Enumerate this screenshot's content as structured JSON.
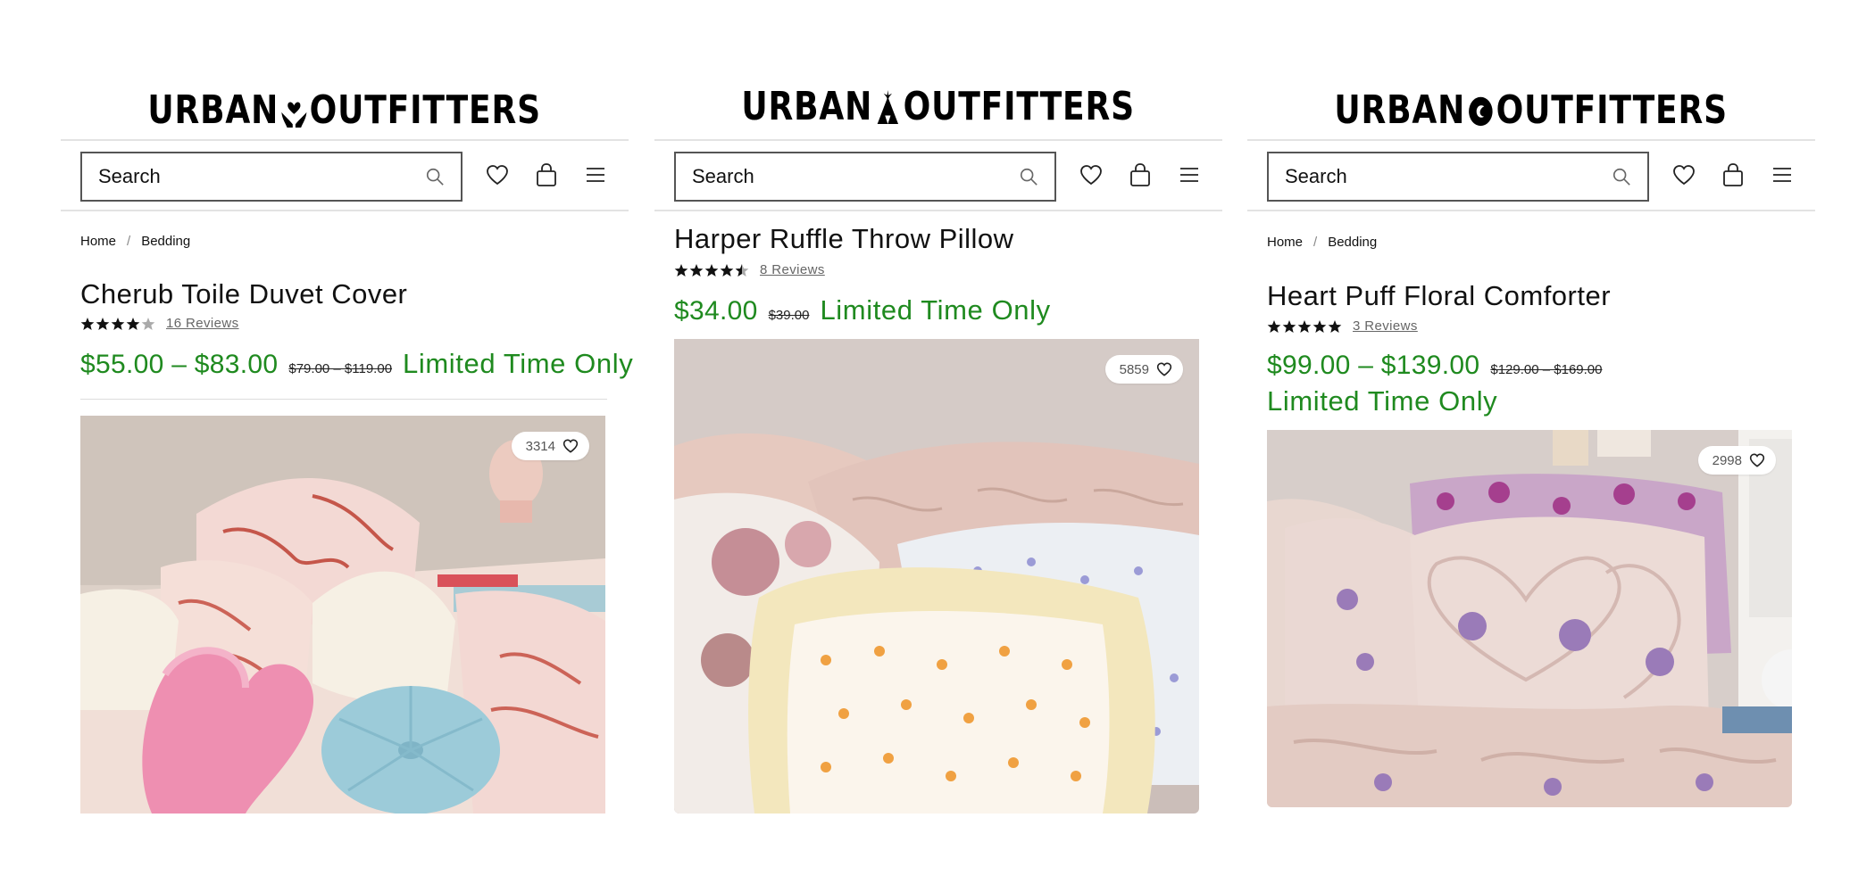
{
  "brand": {
    "logo_left": "URBAN",
    "logo_right": "OUTFITTERS",
    "logo_marks": [
      "hands-heart-logo-mark",
      "tent-logo-mark",
      "circle-logo-mark"
    ]
  },
  "colors": {
    "sale_green": "#1f8a1f",
    "text": "#111111",
    "border": "#555555"
  },
  "panels": [
    {
      "search": {
        "placeholder": "Search"
      },
      "breadcrumb": {
        "home": "Home",
        "separator": "/",
        "category": "Bedding"
      },
      "product": {
        "title": "Cherub Toile Duvet Cover",
        "rating": 4,
        "reviews": "16 Reviews",
        "price": "$55.00 – $83.00",
        "original_price": "$79.00 – $119.00",
        "promo": "Limited Time Only",
        "favorites": "3314"
      }
    },
    {
      "search": {
        "placeholder": "Search"
      },
      "product": {
        "title": "Harper Ruffle Throw Pillow",
        "rating": 4.5,
        "reviews": "8 Reviews",
        "price": "$34.00",
        "original_price": "$39.00",
        "promo": "Limited Time Only",
        "favorites": "5859"
      }
    },
    {
      "search": {
        "placeholder": "Search"
      },
      "breadcrumb": {
        "home": "Home",
        "separator": "/",
        "category": "Bedding"
      },
      "product": {
        "title": "Heart Puff Floral Comforter",
        "rating": 5,
        "reviews": "3 Reviews",
        "price": "$99.00 – $139.00",
        "original_price": "$129.00 – $169.00",
        "promo": "Limited Time Only",
        "favorites": "2998"
      }
    }
  ]
}
